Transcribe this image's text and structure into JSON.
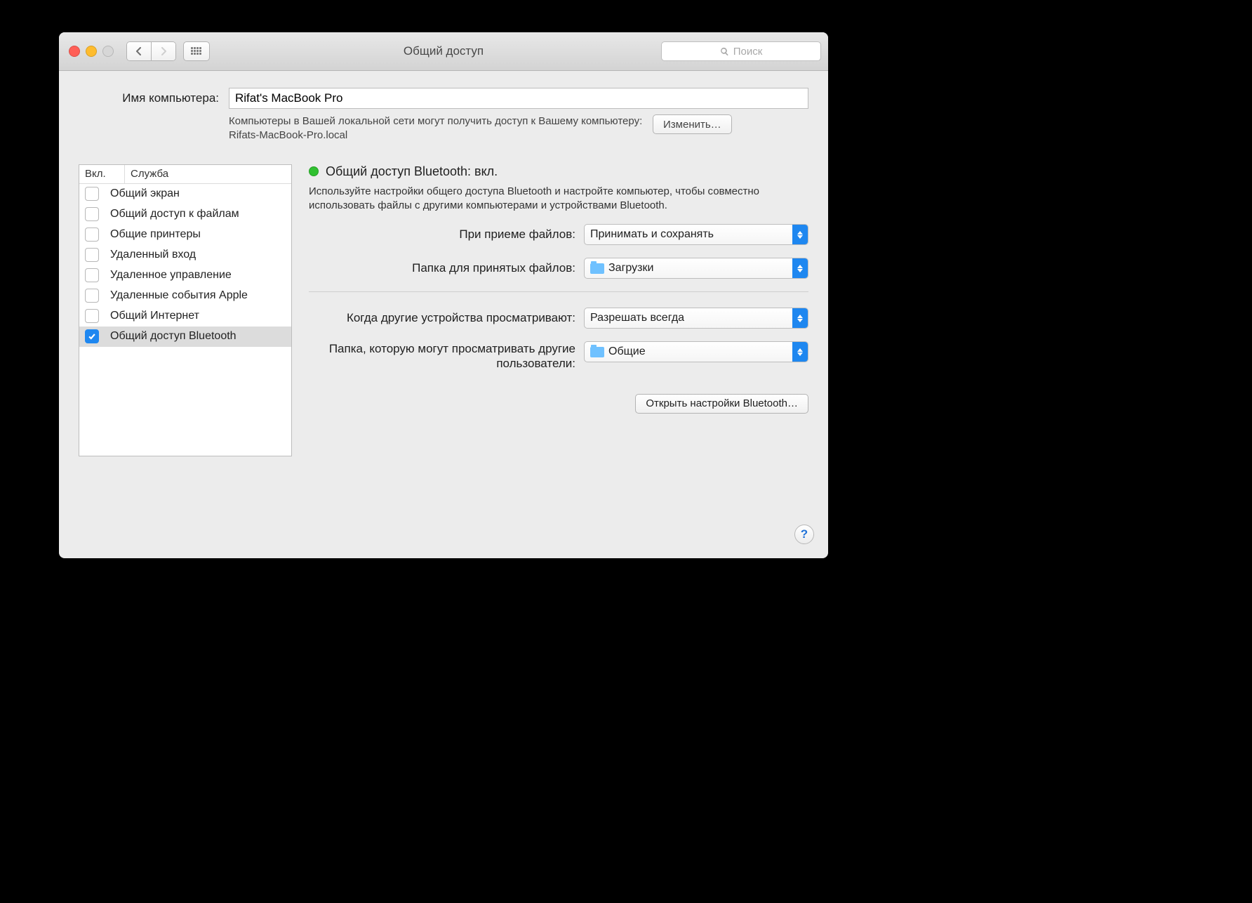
{
  "window": {
    "title": "Общий доступ"
  },
  "search": {
    "placeholder": "Поиск"
  },
  "computer_name": {
    "label": "Имя компьютера:",
    "value": "Rifat's MacBook Pro",
    "description": "Компьютеры в Вашей локальной сети могут получить доступ к Вашему компьютеру: Rifats-MacBook-Pro.local",
    "edit_button": "Изменить…"
  },
  "table": {
    "col_on": "Вкл.",
    "col_service": "Служба",
    "rows": [
      {
        "on": false,
        "name": "Общий экран"
      },
      {
        "on": false,
        "name": "Общий доступ к файлам"
      },
      {
        "on": false,
        "name": "Общие принтеры"
      },
      {
        "on": false,
        "name": "Удаленный вход"
      },
      {
        "on": false,
        "name": "Удаленное управление"
      },
      {
        "on": false,
        "name": "Удаленные события Apple"
      },
      {
        "on": false,
        "name": "Общий Интернет"
      },
      {
        "on": true,
        "name": "Общий доступ Bluetooth"
      }
    ],
    "selected_index": 7
  },
  "detail": {
    "status": "Общий доступ Bluetooth: вкл.",
    "description": "Используйте настройки общего доступа Bluetooth и настройте компьютер, чтобы совместно использовать файлы с другими компьютерами и устройствами Bluetooth.",
    "receive_label": "При приеме файлов:",
    "receive_value": "Принимать и сохранять",
    "receive_folder_label": "Папка для принятых файлов:",
    "receive_folder_value": "Загрузки",
    "browse_label": "Когда другие устройства просматривают:",
    "browse_value": "Разрешать всегда",
    "browse_folder_label": "Папка, которую могут просматривать другие пользователи:",
    "browse_folder_value": "Общие",
    "open_bt_button": "Открыть настройки Bluetooth…"
  }
}
